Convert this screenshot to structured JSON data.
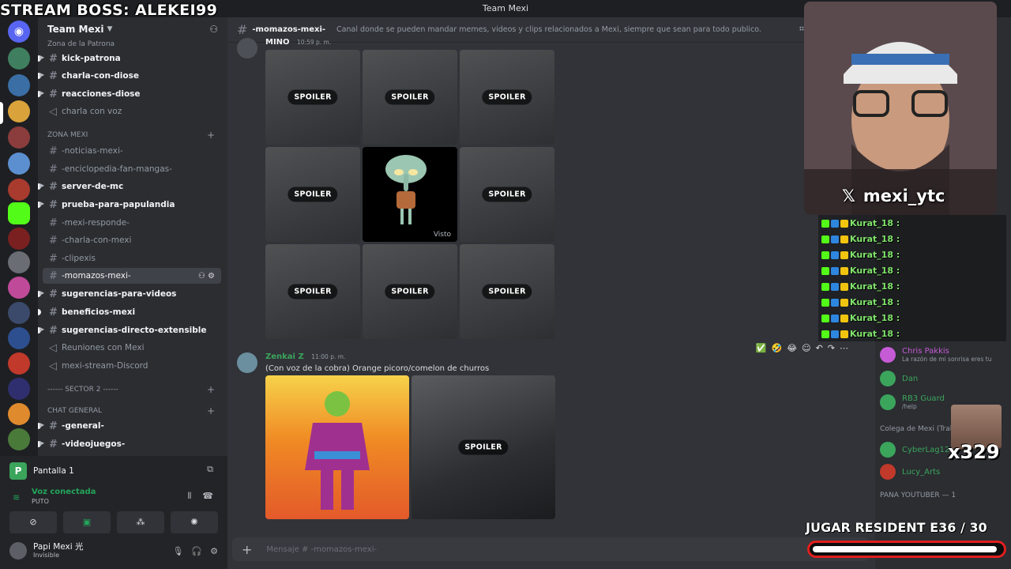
{
  "window": {
    "title": "Team Mexi"
  },
  "stream": {
    "boss_label": "STREAM BOSS: ALEKEI99",
    "handle": "mexi_ytc",
    "chat_user": "Kurat_18 :",
    "emote_count": "x329",
    "goal_label": "JUGAR RESIDENT E36",
    "goal_target": "/ 30",
    "goal_progress": 0.98,
    "accent": "#e01e1e"
  },
  "server": {
    "name": "Team Mexi",
    "invite_icon": "add-member-icon"
  },
  "sidebar": {
    "top_partial": "Zona de la Patrona",
    "channels_a": [
      {
        "label": "kick-patrona",
        "type": "text",
        "unread": true
      },
      {
        "label": "charla-con-diose",
        "type": "text",
        "unread": true
      },
      {
        "label": "reacciones-diose",
        "type": "text",
        "unread": true
      },
      {
        "label": "charla con voz",
        "type": "voice",
        "unread": false
      }
    ],
    "category_mexi": "ZONA MEXI",
    "channels_b": [
      {
        "label": "-noticias-mexi-",
        "type": "text",
        "unread": false
      },
      {
        "label": "-enciclopedia-fan-mangas-",
        "type": "text",
        "unread": false
      },
      {
        "label": "server-de-mc",
        "type": "text",
        "unread": true
      },
      {
        "label": "prueba-para-papulandia",
        "type": "text",
        "unread": true
      },
      {
        "label": "-mexi-responde-",
        "type": "text",
        "unread": false
      },
      {
        "label": "-charla-con-mexi",
        "type": "text",
        "unread": false
      },
      {
        "label": "-clipexis",
        "type": "text",
        "unread": false
      },
      {
        "label": "-momazos-mexi-",
        "type": "text",
        "unread": false,
        "active": true
      },
      {
        "label": "sugerencias-para-videos",
        "type": "text",
        "unread": true
      },
      {
        "label": "beneficios-mexi",
        "type": "text",
        "unread": true
      },
      {
        "label": "sugerencias-directo-extensible",
        "type": "text",
        "unread": true
      },
      {
        "label": "Reuniones con Mexi",
        "type": "voice",
        "unread": false
      },
      {
        "label": "mexi-stream-Discord",
        "type": "voice",
        "unread": false
      }
    ],
    "category_sector": "------ SECTOR 2 ------",
    "category_chat": "CHAT GENERAL",
    "channels_c": [
      {
        "label": "-general-",
        "type": "text",
        "unread": true
      },
      {
        "label": "-videojuegos-",
        "type": "text",
        "unread": true
      }
    ]
  },
  "panel": {
    "screen": "Pantalla 1",
    "voice_status": "Voz conectada",
    "voice_channel": "PUTO",
    "user_name": "Papi Mexi 光",
    "user_status": "Invisible"
  },
  "chat": {
    "channel_name": "-momazos-mexi-",
    "topic": "Canal donde se pueden mandar memes, videos y clips relacionados a Mexi, siempre que sean para todo publico.",
    "msg1_author": "MINO",
    "msg1_time": "10:59 p. m.",
    "spoiler_label": "SPOILER",
    "seen_label": "Visto",
    "msg2_author": "Zenkai Z",
    "msg2_time": "11:00 p. m.",
    "msg2_text": "(Con voz de la cobra) Orange picoro/comelon de churros",
    "composer_placeholder": "Mensaje # -momazos-mexi-"
  },
  "members": {
    "list": [
      {
        "name": "Chris Pakkis",
        "status": "La razón de mi sonrisa eres tu",
        "color": "#c65bd6"
      },
      {
        "name": "Dan",
        "status": "",
        "color": "#3ba55c"
      },
      {
        "name": "RB3 Guard",
        "status": "/help",
        "color": "#3ba55c"
      }
    ],
    "group_colega": "Colega de Mexi (Trabajo)",
    "list2": [
      {
        "name": "CyberLag12",
        "status": "",
        "color": "#3ba55c"
      },
      {
        "name": "Lucy_Arts",
        "status": "",
        "color": "#3ba55c"
      }
    ],
    "group_pana": "PANA YOUTUBER — 1"
  }
}
